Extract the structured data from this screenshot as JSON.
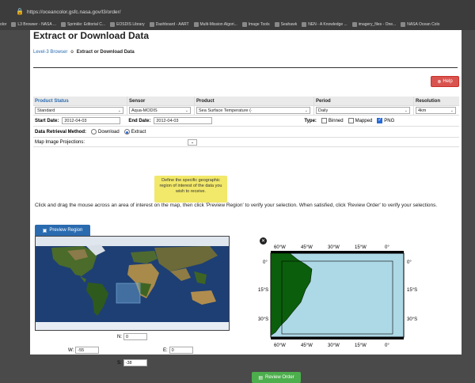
{
  "browser": {
    "url": "https://oceancolor.gsfc.nasa.gov/l3/order/",
    "bookmarks": [
      "olor",
      "L3 Browser - NASA ...",
      "Sprinkle: Editorial C...",
      "EOSDIS Library",
      "Dashboard - AART",
      "Multi-Mission Algori...",
      "Image Tools",
      "Seahawk",
      "NEN - A Knowledge ...",
      "imagery_files - One...",
      "NASA Ocean Colo"
    ]
  },
  "page": {
    "title": "Extract or Download Data",
    "breadcrumb": {
      "link": "Level-3 Browser",
      "current": "Extract or Download Data"
    },
    "help_label": "Help"
  },
  "grid": {
    "headers": [
      "Product Status",
      "Sensor",
      "Product",
      "Period",
      "Resolution"
    ],
    "product_status": "Standard",
    "sensor": "Aqua-MODIS",
    "product": "Sea Surface Temperature (·",
    "period": "Daily",
    "resolution": "4km",
    "start_label": "Start Date:",
    "start_value": "2012-04-03",
    "end_label": "End Date:",
    "end_value": "2012-04-03",
    "type_label": "Type:",
    "types": [
      "Binned",
      "Mapped",
      "PNG"
    ],
    "type_checked": "PNG",
    "method_label": "Data Retrieval Method:",
    "methods": [
      "Download",
      "Extract"
    ],
    "method_selected": "Extract",
    "projection_label": "Map Image Projections:"
  },
  "tooltip": "Define the specific geographic region of interest of the data you wish to receive.",
  "instructions": "Click and drag the mouse across an area of interest on the map, then click 'Preview Region' to verify your selection. When satisfied, click 'Review Order' to verify your selections.",
  "preview_label": "Preview Region",
  "coords": {
    "N_label": "N:",
    "N": "0",
    "W_label": "W:",
    "W": "-55",
    "E_label": "E:",
    "E": "0",
    "S_label": "S:",
    "S": "-38"
  },
  "region_map": {
    "lon_labels": [
      "60°W",
      "45°W",
      "30°W",
      "15°W",
      "0°"
    ],
    "lat_labels": [
      "0°",
      "15°S",
      "30°S"
    ]
  },
  "review_label": "Review Order",
  "colors": {
    "help": "#d9534f",
    "preview": "#2a6bb0",
    "review": "#4cae4c",
    "ocean": "#add8e6",
    "land": "#0b5e0b"
  }
}
